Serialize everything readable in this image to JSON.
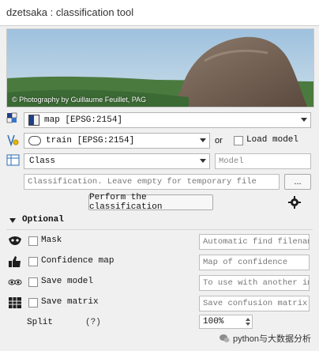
{
  "window": {
    "title": "dzetsaka : classification tool"
  },
  "banner": {
    "credit": "© Photography by Guillaume Feuillet, PAG"
  },
  "inputs": {
    "raster_layer": "map [EPSG:2154]",
    "train_layer": "train [EPSG:2154]",
    "or_label": "or",
    "load_model_label": "Load model",
    "class_field": "Class",
    "model_placeholder": "Model",
    "output_placeholder": "Classification. Leave empty for temporary file",
    "browse_label": "...",
    "perform_button": "Perform the classification"
  },
  "optional": {
    "title": "Optional",
    "mask_label": "Mask",
    "mask_placeholder": "Automatic find filenam",
    "confidence_label": "Confidence map",
    "confidence_placeholder": "Map of confidence",
    "save_model_label": "Save model",
    "save_model_placeholder": "To use with another im",
    "save_matrix_label": "Save matrix",
    "save_matrix_placeholder": "Save confusion matrix",
    "split_label": "Split",
    "split_help": "(?)",
    "split_value": "100%"
  },
  "watermark": {
    "text": "python与大数据分析"
  },
  "colors": {
    "accent": "#3b73c8",
    "border": "#b5b5b5"
  }
}
